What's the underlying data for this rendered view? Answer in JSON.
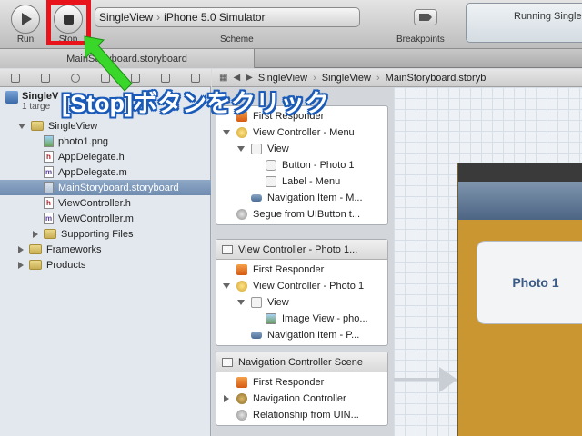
{
  "toolbar": {
    "run_label": "Run",
    "stop_label": "Stop",
    "scheme_target": "SingleView",
    "scheme_device": "iPhone 5.0 Simulator",
    "scheme_label": "Scheme",
    "breakpoints_label": "Breakpoints",
    "status_text": "Running Single"
  },
  "tab": {
    "label": "MainStoryboard.storyboard"
  },
  "jump_bar": {
    "project": "SingleView",
    "folder": "SingleView",
    "file": "MainStoryboard.storyb"
  },
  "navigator": {
    "project_name": "SingleV",
    "project_sub": "1 targe",
    "items": [
      {
        "label": "SingleView",
        "type": "folder",
        "indent": 1,
        "disclosure": "open"
      },
      {
        "label": "photo1.png",
        "type": "img",
        "indent": 2
      },
      {
        "label": "AppDelegate.h",
        "type": "h",
        "indent": 2
      },
      {
        "label": "AppDelegate.m",
        "type": "m",
        "indent": 2
      },
      {
        "label": "MainStoryboard.storyboard",
        "type": "sb",
        "indent": 2,
        "selected": true
      },
      {
        "label": "ViewController.h",
        "type": "h",
        "indent": 2
      },
      {
        "label": "ViewController.m",
        "type": "m",
        "indent": 2
      },
      {
        "label": "Supporting Files",
        "type": "folder",
        "indent": 2,
        "disclosure": "closed"
      },
      {
        "label": "Frameworks",
        "type": "folder",
        "indent": 1,
        "disclosure": "closed"
      },
      {
        "label": "Products",
        "type": "folder",
        "indent": 1,
        "disclosure": "closed"
      }
    ]
  },
  "outline": {
    "scene1": {
      "rows": [
        {
          "label": "First Responder",
          "icon": "fr",
          "depth": 0
        },
        {
          "label": "View Controller - Menu",
          "icon": "vc",
          "depth": 0,
          "disclosure": "open"
        },
        {
          "label": "View",
          "icon": "view",
          "depth": 1,
          "disclosure": "open"
        },
        {
          "label": "Button - Photo 1",
          "icon": "btn",
          "depth": 2
        },
        {
          "label": "Label - Menu",
          "icon": "view",
          "depth": 2
        },
        {
          "label": "Navigation Item - M...",
          "icon": "nav",
          "depth": 1
        },
        {
          "label": "Segue from UIButton t...",
          "icon": "segue",
          "depth": 0
        }
      ]
    },
    "scene2": {
      "title": "View Controller - Photo 1...",
      "rows": [
        {
          "label": "First Responder",
          "icon": "fr",
          "depth": 0
        },
        {
          "label": "View Controller - Photo 1",
          "icon": "vc",
          "depth": 0,
          "disclosure": "open"
        },
        {
          "label": "View",
          "icon": "view",
          "depth": 1,
          "disclosure": "open"
        },
        {
          "label": "Image View - pho...",
          "icon": "img",
          "depth": 2
        },
        {
          "label": "Navigation Item - P...",
          "icon": "nav",
          "depth": 1
        }
      ]
    },
    "scene3": {
      "title": "Navigation Controller Scene",
      "rows": [
        {
          "label": "First Responder",
          "icon": "fr",
          "depth": 0
        },
        {
          "label": "Navigation Controller",
          "icon": "navc",
          "depth": 0,
          "disclosure": "closed"
        },
        {
          "label": "Relationship from UIN...",
          "icon": "segue",
          "depth": 0
        }
      ]
    }
  },
  "canvas": {
    "photo_button": "Photo 1"
  },
  "annotation": {
    "text": "[Stop]ボタンをクリック",
    "highlight_color": "#e8131b",
    "arrow_color": "#39d72a",
    "text_outline_color": "#1b5bb8"
  }
}
